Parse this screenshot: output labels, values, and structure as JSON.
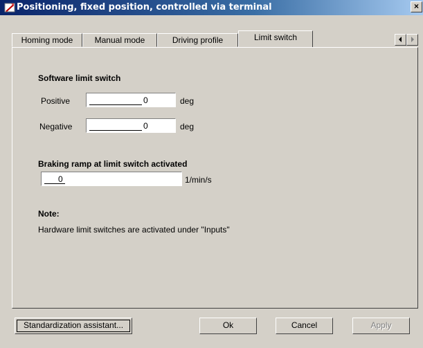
{
  "window": {
    "title": "Positioning, fixed position, controlled via terminal",
    "close_glyph": "×"
  },
  "tabs": [
    {
      "label": "Homing mode"
    },
    {
      "label": "Manual mode"
    },
    {
      "label": "Driving profile"
    },
    {
      "label": "Limit switch",
      "active": true
    }
  ],
  "software_limit": {
    "heading": "Software limit switch",
    "positive_label": "Positive",
    "positive_value": "0",
    "negative_label": "Negative",
    "negative_value": "0",
    "unit": "deg"
  },
  "braking": {
    "heading": "Braking ramp at limit switch activated",
    "value": "0",
    "unit": "1/min/s"
  },
  "note": {
    "heading": "Note:",
    "text": "Hardware limit switches are activated under \"Inputs\""
  },
  "buttons": {
    "standardization": "Standardization assistant...",
    "ok": "Ok",
    "cancel": "Cancel",
    "apply": "Apply"
  },
  "icons": {
    "app": "app-tool-icon",
    "scroll_left": "triangle-left-icon",
    "scroll_right": "triangle-right-icon"
  }
}
